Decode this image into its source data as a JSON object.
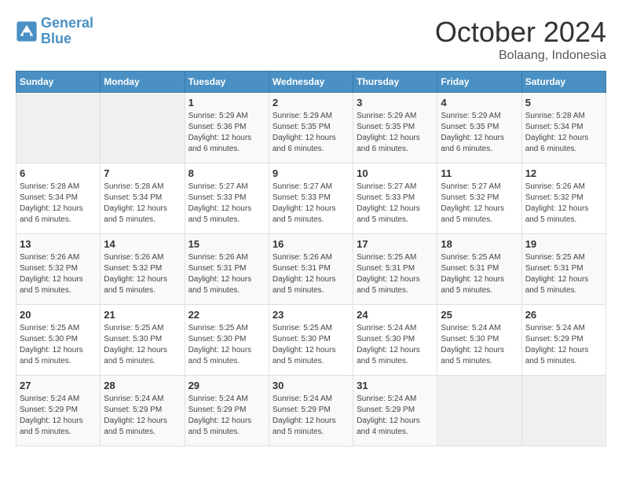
{
  "logo": {
    "line1": "General",
    "line2": "Blue"
  },
  "title": "October 2024",
  "location": "Bolaang, Indonesia",
  "days_of_week": [
    "Sunday",
    "Monday",
    "Tuesday",
    "Wednesday",
    "Thursday",
    "Friday",
    "Saturday"
  ],
  "weeks": [
    [
      {
        "day": "",
        "info": ""
      },
      {
        "day": "",
        "info": ""
      },
      {
        "day": "1",
        "info": "Sunrise: 5:29 AM\nSunset: 5:36 PM\nDaylight: 12 hours and 6 minutes."
      },
      {
        "day": "2",
        "info": "Sunrise: 5:29 AM\nSunset: 5:35 PM\nDaylight: 12 hours and 6 minutes."
      },
      {
        "day": "3",
        "info": "Sunrise: 5:29 AM\nSunset: 5:35 PM\nDaylight: 12 hours and 6 minutes."
      },
      {
        "day": "4",
        "info": "Sunrise: 5:29 AM\nSunset: 5:35 PM\nDaylight: 12 hours and 6 minutes."
      },
      {
        "day": "5",
        "info": "Sunrise: 5:28 AM\nSunset: 5:34 PM\nDaylight: 12 hours and 6 minutes."
      }
    ],
    [
      {
        "day": "6",
        "info": "Sunrise: 5:28 AM\nSunset: 5:34 PM\nDaylight: 12 hours and 6 minutes."
      },
      {
        "day": "7",
        "info": "Sunrise: 5:28 AM\nSunset: 5:34 PM\nDaylight: 12 hours and 5 minutes."
      },
      {
        "day": "8",
        "info": "Sunrise: 5:27 AM\nSunset: 5:33 PM\nDaylight: 12 hours and 5 minutes."
      },
      {
        "day": "9",
        "info": "Sunrise: 5:27 AM\nSunset: 5:33 PM\nDaylight: 12 hours and 5 minutes."
      },
      {
        "day": "10",
        "info": "Sunrise: 5:27 AM\nSunset: 5:33 PM\nDaylight: 12 hours and 5 minutes."
      },
      {
        "day": "11",
        "info": "Sunrise: 5:27 AM\nSunset: 5:32 PM\nDaylight: 12 hours and 5 minutes."
      },
      {
        "day": "12",
        "info": "Sunrise: 5:26 AM\nSunset: 5:32 PM\nDaylight: 12 hours and 5 minutes."
      }
    ],
    [
      {
        "day": "13",
        "info": "Sunrise: 5:26 AM\nSunset: 5:32 PM\nDaylight: 12 hours and 5 minutes."
      },
      {
        "day": "14",
        "info": "Sunrise: 5:26 AM\nSunset: 5:32 PM\nDaylight: 12 hours and 5 minutes."
      },
      {
        "day": "15",
        "info": "Sunrise: 5:26 AM\nSunset: 5:31 PM\nDaylight: 12 hours and 5 minutes."
      },
      {
        "day": "16",
        "info": "Sunrise: 5:26 AM\nSunset: 5:31 PM\nDaylight: 12 hours and 5 minutes."
      },
      {
        "day": "17",
        "info": "Sunrise: 5:25 AM\nSunset: 5:31 PM\nDaylight: 12 hours and 5 minutes."
      },
      {
        "day": "18",
        "info": "Sunrise: 5:25 AM\nSunset: 5:31 PM\nDaylight: 12 hours and 5 minutes."
      },
      {
        "day": "19",
        "info": "Sunrise: 5:25 AM\nSunset: 5:31 PM\nDaylight: 12 hours and 5 minutes."
      }
    ],
    [
      {
        "day": "20",
        "info": "Sunrise: 5:25 AM\nSunset: 5:30 PM\nDaylight: 12 hours and 5 minutes."
      },
      {
        "day": "21",
        "info": "Sunrise: 5:25 AM\nSunset: 5:30 PM\nDaylight: 12 hours and 5 minutes."
      },
      {
        "day": "22",
        "info": "Sunrise: 5:25 AM\nSunset: 5:30 PM\nDaylight: 12 hours and 5 minutes."
      },
      {
        "day": "23",
        "info": "Sunrise: 5:25 AM\nSunset: 5:30 PM\nDaylight: 12 hours and 5 minutes."
      },
      {
        "day": "24",
        "info": "Sunrise: 5:24 AM\nSunset: 5:30 PM\nDaylight: 12 hours and 5 minutes."
      },
      {
        "day": "25",
        "info": "Sunrise: 5:24 AM\nSunset: 5:30 PM\nDaylight: 12 hours and 5 minutes."
      },
      {
        "day": "26",
        "info": "Sunrise: 5:24 AM\nSunset: 5:29 PM\nDaylight: 12 hours and 5 minutes."
      }
    ],
    [
      {
        "day": "27",
        "info": "Sunrise: 5:24 AM\nSunset: 5:29 PM\nDaylight: 12 hours and 5 minutes."
      },
      {
        "day": "28",
        "info": "Sunrise: 5:24 AM\nSunset: 5:29 PM\nDaylight: 12 hours and 5 minutes."
      },
      {
        "day": "29",
        "info": "Sunrise: 5:24 AM\nSunset: 5:29 PM\nDaylight: 12 hours and 5 minutes."
      },
      {
        "day": "30",
        "info": "Sunrise: 5:24 AM\nSunset: 5:29 PM\nDaylight: 12 hours and 5 minutes."
      },
      {
        "day": "31",
        "info": "Sunrise: 5:24 AM\nSunset: 5:29 PM\nDaylight: 12 hours and 4 minutes."
      },
      {
        "day": "",
        "info": ""
      },
      {
        "day": "",
        "info": ""
      }
    ]
  ]
}
